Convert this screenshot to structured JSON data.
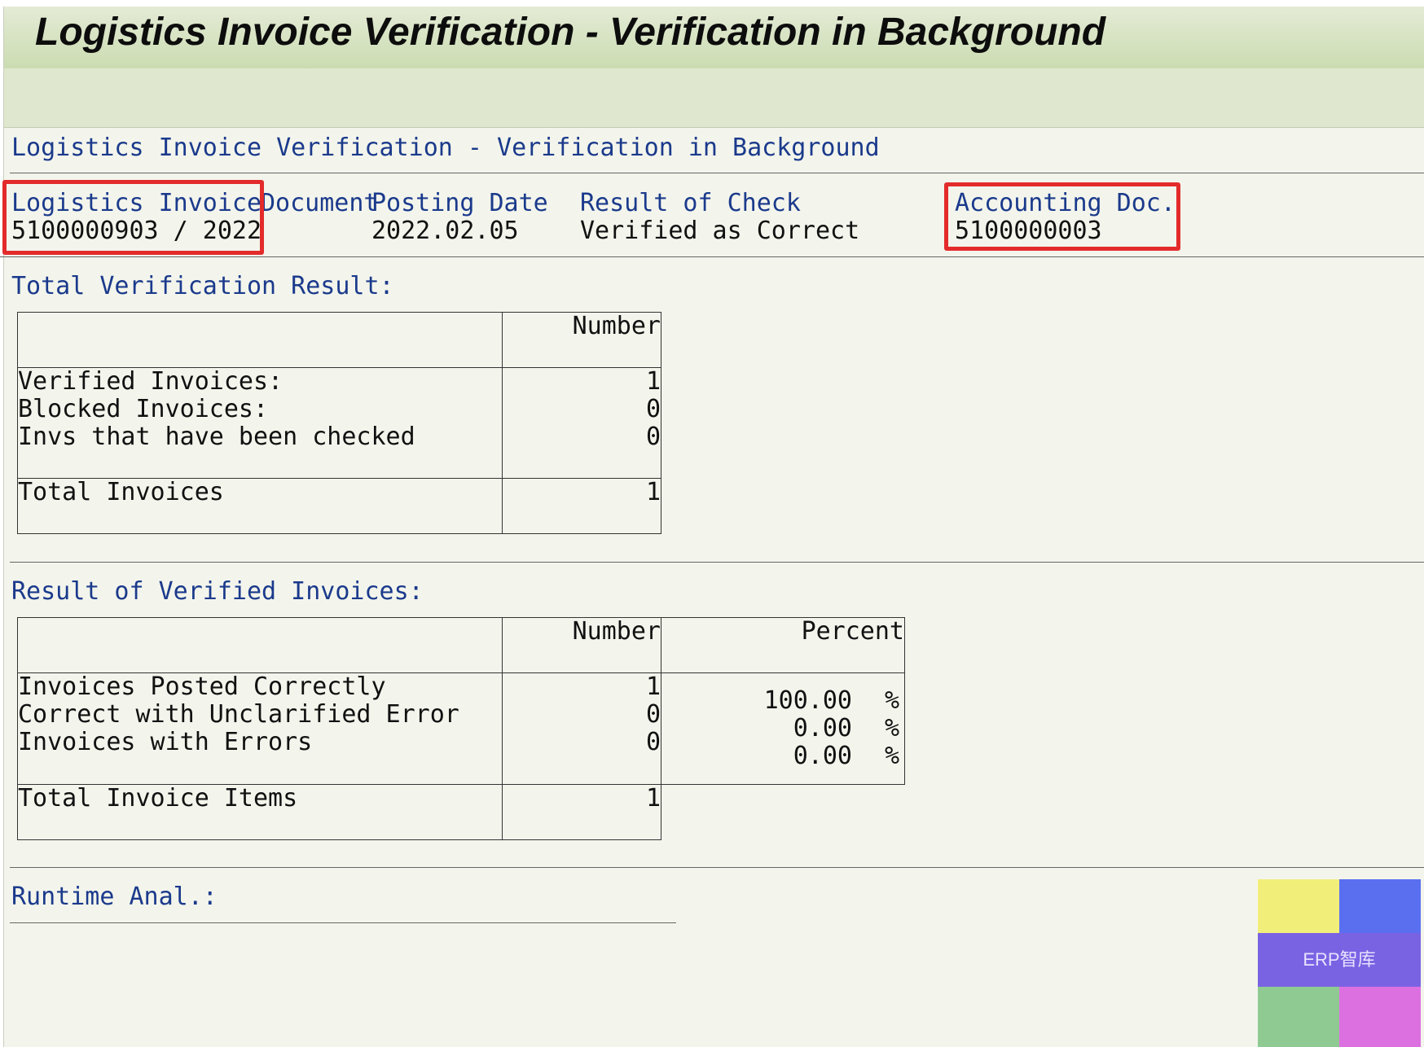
{
  "window": {
    "title": "Logistics Invoice Verification - Verification in Background"
  },
  "report": {
    "heading": "Logistics Invoice Verification - Verification in Background",
    "header_columns": {
      "logistics_invoice_label": "Logistics Invoice",
      "document_label": "Document",
      "posting_date_label": "Posting Date",
      "result_of_check_label": "Result of Check",
      "accounting_doc_label": "Accounting Doc."
    },
    "header_values": {
      "logistics_invoice": "5100000903 / 2022",
      "posting_date": "2022.02.05",
      "result_of_check": "Verified as Correct",
      "accounting_doc": "5100000003"
    },
    "total_verification": {
      "title": "Total Verification Result:",
      "number_header": "Number",
      "rows": [
        {
          "label": "Verified Invoices:",
          "number": "1"
        },
        {
          "label": "Blocked Invoices:",
          "number": "0"
        },
        {
          "label": "Invs that have been checked",
          "number": "0"
        }
      ],
      "total_label": "Total Invoices",
      "total_number": "1"
    },
    "verified_results": {
      "title": "Result of Verified Invoices:",
      "number_header": "Number",
      "percent_header": "Percent",
      "rows": [
        {
          "label": "Invoices Posted Correctly",
          "number": "1",
          "percent": "100.00",
          "unit": "%"
        },
        {
          "label": "Correct with Unclarified Error",
          "number": "0",
          "percent": "0.00",
          "unit": "%"
        },
        {
          "label": "Invoices with Errors",
          "number": "0",
          "percent": "0.00",
          "unit": "%"
        }
      ],
      "total_label": "Total Invoice Items",
      "total_number": "1"
    },
    "runtime": {
      "title": "Runtime Anal.:"
    }
  },
  "watermark": {
    "text": "ERP智库",
    "colors": {
      "yellow": "#f2ee7a",
      "blue": "#5a6ff0",
      "purple": "#7a63e3",
      "green": "#8fca92",
      "pink": "#dc70e0"
    }
  },
  "highlight_color": "#e32b2b"
}
